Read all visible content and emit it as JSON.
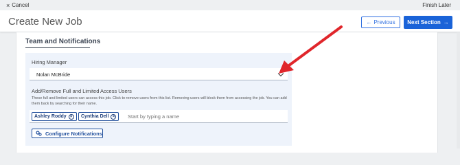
{
  "topbar": {
    "cancel_label": "Cancel",
    "finish_label": "Finish Later"
  },
  "header": {
    "title": "Create New Job",
    "previous_label": "Previous",
    "next_label": "Next Section"
  },
  "section": {
    "title": "Team and Notifications"
  },
  "hiring_manager": {
    "label": "Hiring Manager",
    "value": "Nolan McBride"
  },
  "access_users": {
    "label": "Add/Remove Full and Limited Access Users",
    "help_text": "These full and limited users can access this job. Click to remove users from this list. Removing users will block them from accessing the job. You can add them back by searching for their name.",
    "chips": [
      "Ashley Roddy",
      "Cynthia Dell"
    ],
    "placeholder": "Start by typing a name"
  },
  "configure_label": "Configure Notifications",
  "colors": {
    "primary": "#1a63d8",
    "annotation_arrow": "#e0262b",
    "panel_bg": "#eef3fb"
  },
  "icons": {
    "cancel": "close-icon",
    "previous": "arrow-left-icon",
    "next": "arrow-right-icon",
    "dropdown": "chevron-down-icon",
    "configure": "gear-icon",
    "chip_remove": "remove-circle-icon"
  }
}
